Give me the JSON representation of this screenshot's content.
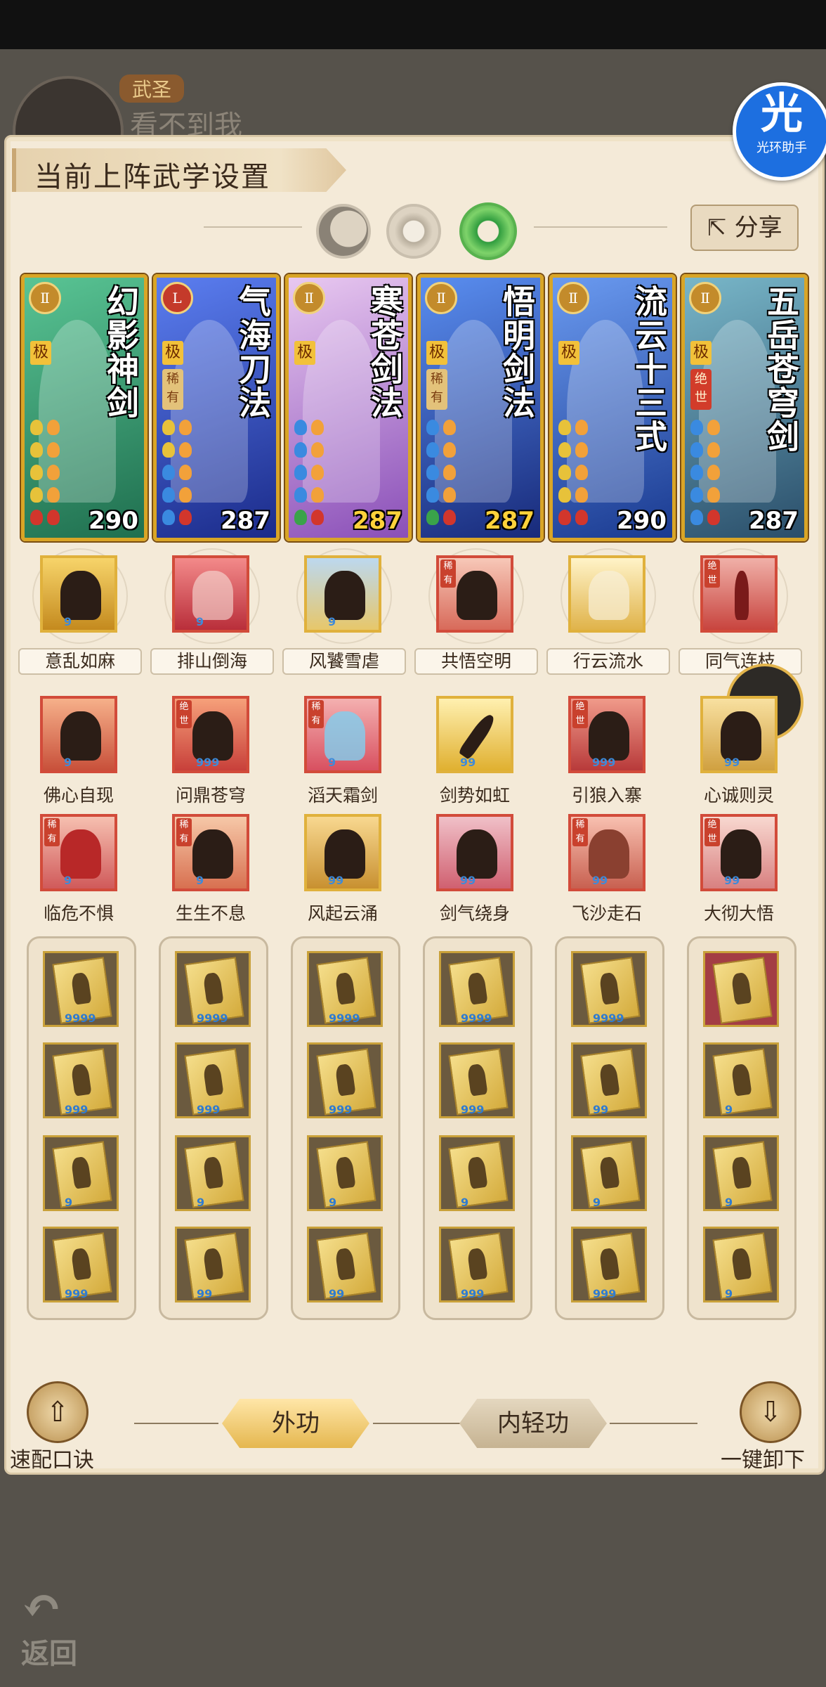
{
  "player": {
    "rank": "武圣",
    "name": "看不到我"
  },
  "panel": {
    "title": "当前上阵武学设置",
    "share_label": "分享"
  },
  "badge": {
    "big": "光",
    "small": "光环助手"
  },
  "cards": [
    {
      "name": "幻影神剑",
      "grade": "极",
      "rarity": "",
      "power": "290",
      "power_color": "white",
      "bg": "#3aa37a"
    },
    {
      "name": "气海刀法",
      "grade": "极",
      "rarity": "稀有",
      "power": "287",
      "power_color": "white",
      "bg": "#3b55c8"
    },
    {
      "name": "寒苍剑法",
      "grade": "极",
      "rarity": "",
      "power": "287",
      "power_color": "gold",
      "bg": "#b97ad6"
    },
    {
      "name": "悟明剑法",
      "grade": "极",
      "rarity": "稀有",
      "power": "287",
      "power_color": "gold",
      "bg": "#3a5ad0"
    },
    {
      "name": "流云十三式",
      "grade": "极",
      "rarity": "",
      "power": "290",
      "power_color": "white",
      "bg": "#4a7ad8"
    },
    {
      "name": "五岳苍穹剑",
      "grade": "极",
      "rarity": "绝世",
      "power": "287",
      "power_color": "white",
      "bg": "#4a8a9a"
    }
  ],
  "skills_row1": [
    "意乱如麻",
    "排山倒海",
    "风饕雪虐",
    "共悟空明",
    "行云流水",
    "同气连枝"
  ],
  "skills_row2": [
    "佛心自现",
    "问鼎苍穹",
    "滔天霜剑",
    "剑势如虹",
    "引狼入寨",
    "心诚则灵"
  ],
  "skills_row3": [
    "临危不惧",
    "生生不息",
    "风起云涌",
    "剑气绕身",
    "飞沙走石",
    "大彻大悟"
  ],
  "bottom": {
    "quick_label": "速配口诀",
    "tab_outer": "外功",
    "tab_inner": "内轻功",
    "unload_label": "一键卸下"
  },
  "back_label": "返回"
}
